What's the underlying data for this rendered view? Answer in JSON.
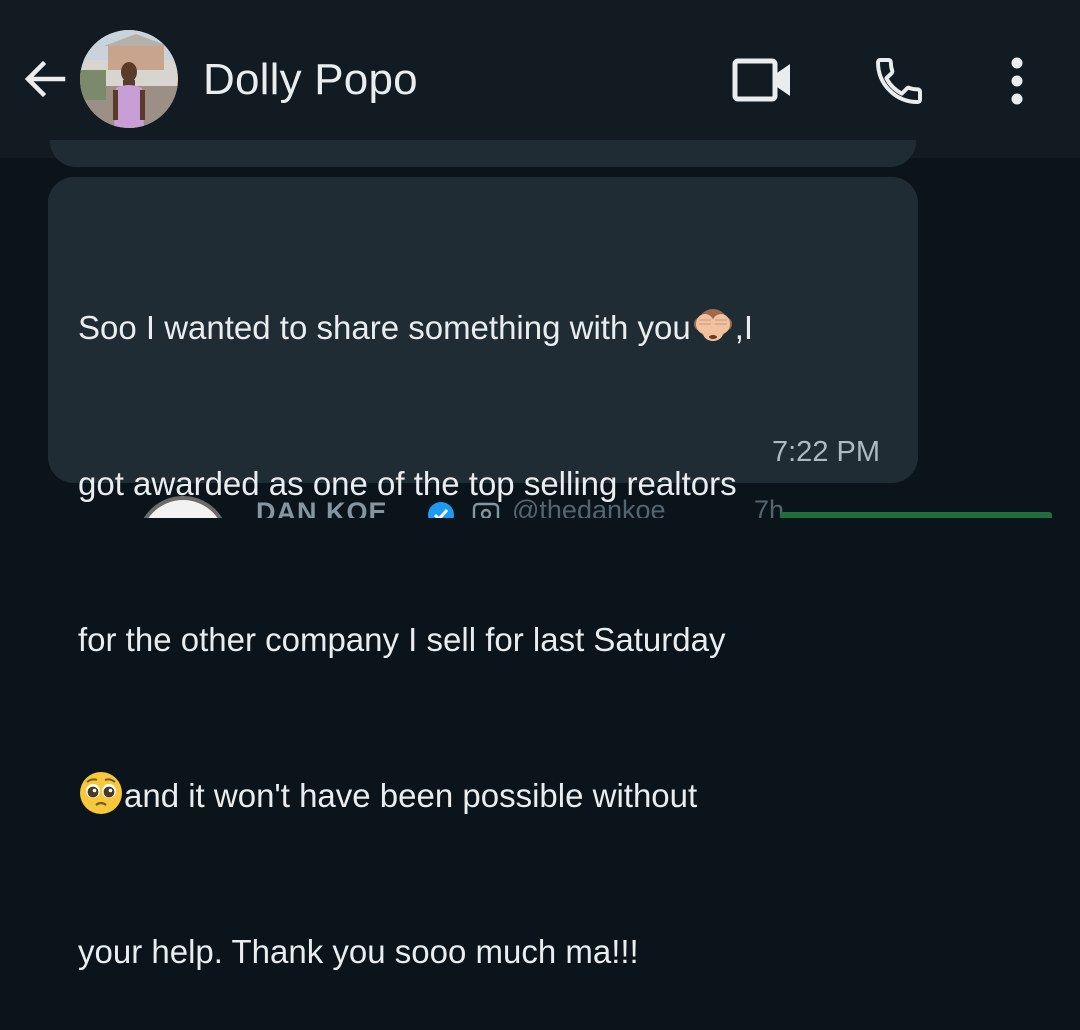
{
  "header": {
    "contact_name": "Dolly Popo",
    "icons": [
      "arrow-left-icon",
      "video-camera-icon",
      "phone-icon",
      "kebab-menu-icon"
    ]
  },
  "message": {
    "lines": [
      "Soo I wanted to share something with you",
      ",I",
      "got awarded as one of the top selling realtors",
      "for the other company I sell for last Saturday",
      "and it won't have been possible without",
      "your help. Thank you sooo much ma!!!"
    ],
    "emojis": [
      "see-no-evil-monkey",
      "pleading-face"
    ],
    "time": "7:22 PM"
  },
  "next_message": {
    "name": "DAN KOE",
    "handle": "@thedankoe",
    "ago": "7h"
  },
  "colors": {
    "background": "#0b141a",
    "header": "#111b21",
    "bubble": "#202c33",
    "text": "#e9edef",
    "meta": "#aebac1",
    "verified": "#1d9bf0"
  }
}
